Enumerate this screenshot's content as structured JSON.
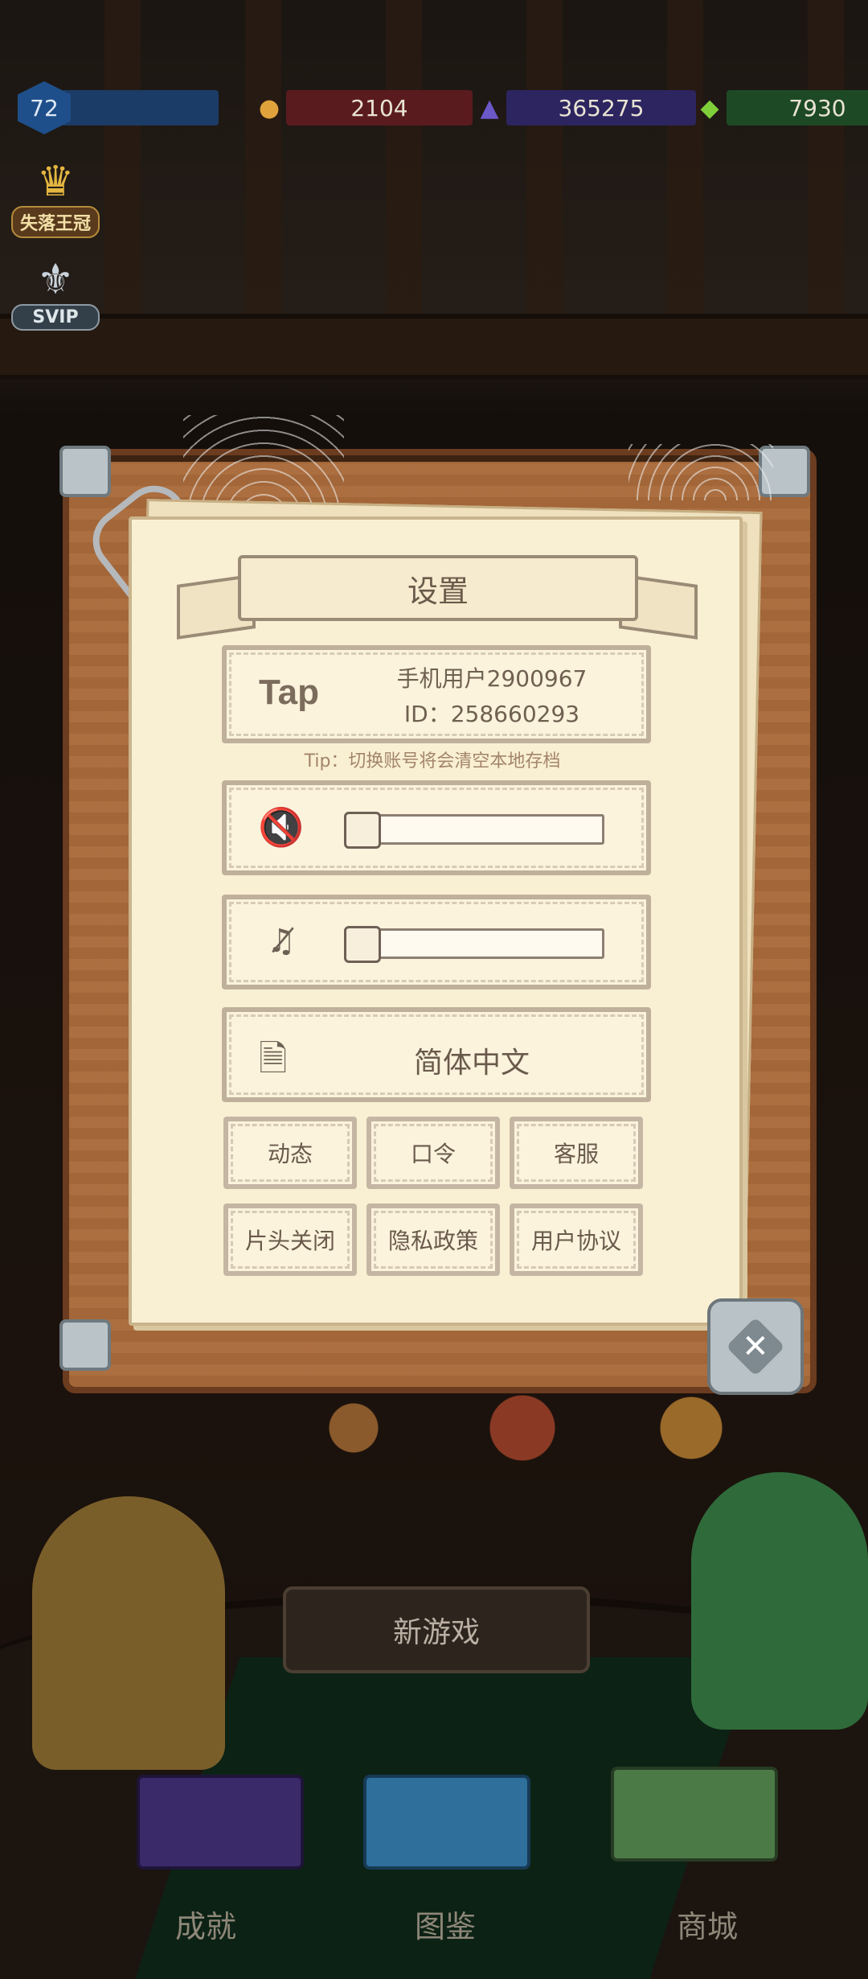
{
  "hud": {
    "level": "72",
    "coins": "2104",
    "gems": "365275",
    "crystals": "7930"
  },
  "side_badges": {
    "crown_label": "失落王冠",
    "vip_label": "SVIP"
  },
  "settings": {
    "title": "设置",
    "account": {
      "logo": "Tap",
      "name": "手机用户2900967",
      "id": "ID：258660293"
    },
    "tip": "Tip：切换账号将会清空本地存档",
    "sound_level": 0,
    "music_level": 0,
    "language": "简体中文",
    "buttons": [
      "动态",
      "口令",
      "客服",
      "片头关闭",
      "隐私政策",
      "用户协议"
    ]
  },
  "main": {
    "new_game": "新游戏"
  },
  "bottom_nav": {
    "achievements": "成就",
    "codex": "图鉴",
    "shop": "商城"
  },
  "colors": {
    "paper": "#f9f0d4",
    "board": "#a96a3a",
    "level_bar": "#1b3c66",
    "coin_bar": "#5a1b1e",
    "gem_bar": "#2c2560",
    "crystal_bar": "#1d4a24"
  }
}
